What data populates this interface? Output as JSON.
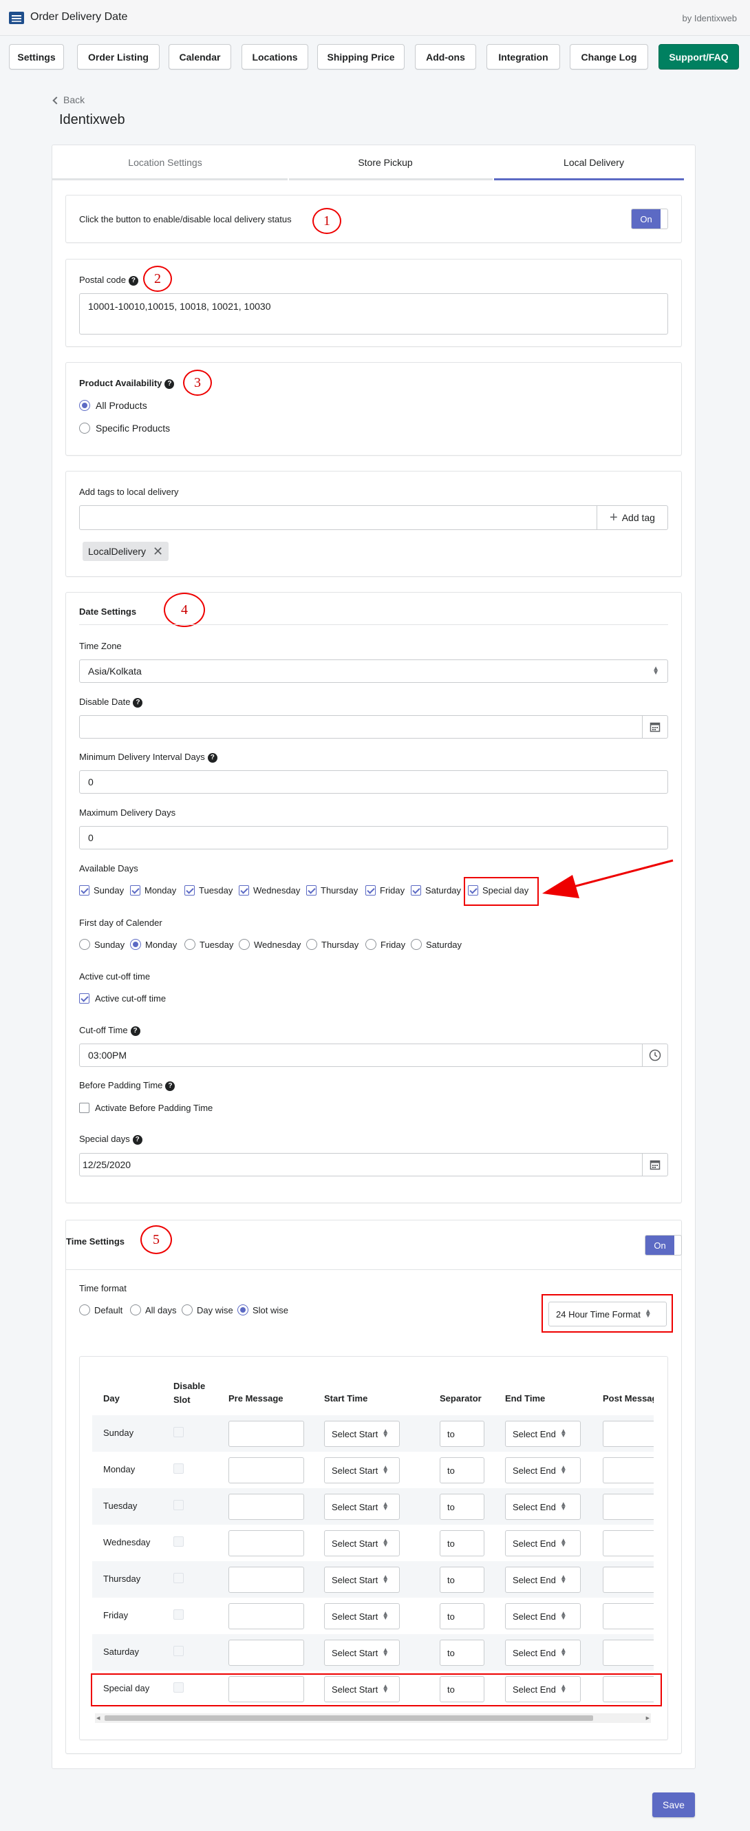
{
  "header": {
    "app_title": "Order Delivery Date",
    "by": "by Identixweb"
  },
  "nav": [
    "Settings",
    "Order Listing",
    "Calendar",
    "Locations",
    "Shipping Price",
    "Add-ons",
    "Integration",
    "Change Log",
    "Support/FAQ"
  ],
  "back_label": "Back",
  "page_title": "Identixweb",
  "tabs": [
    "Location Settings",
    "Store Pickup",
    "Local Delivery"
  ],
  "active_tab": "Local Delivery",
  "annotations": [
    "1",
    "2",
    "3",
    "4",
    "5"
  ],
  "status": {
    "text": "Click the button to enable/disable local delivery status",
    "toggle": "On"
  },
  "postal": {
    "label": "Postal code",
    "value": "10001-10010,10015, 10018, 10021, 10030"
  },
  "product": {
    "title": "Product Availability",
    "options": [
      "All Products",
      "Specific Products"
    ],
    "selected": "All Products"
  },
  "tags": {
    "label": "Add tags to local delivery",
    "button": "Add tag",
    "chip": "LocalDelivery"
  },
  "date_settings": {
    "title": "Date Settings",
    "timezone_label": "Time Zone",
    "timezone_value": "Asia/Kolkata",
    "disable_date_label": "Disable Date",
    "min_interval_label": "Minimum Delivery Interval Days",
    "min_interval_value": "0",
    "max_days_label": "Maximum Delivery Days",
    "max_days_value": "0",
    "available_days_label": "Available Days",
    "available_days": [
      "Sunday",
      "Monday",
      "Tuesday",
      "Wednesday",
      "Thursday",
      "Friday",
      "Saturday",
      "Special day"
    ],
    "first_day_label": "First day of Calender",
    "first_days": [
      "Sunday",
      "Monday",
      "Tuesday",
      "Wednesday",
      "Thursday",
      "Friday",
      "Saturday"
    ],
    "first_day_selected": "Monday",
    "cutoff_section_label": "Active cut-off time",
    "cutoff_checkbox_label": "Active cut-off time",
    "cutoff_time_label": "Cut-off Time",
    "cutoff_time_value": "03:00PM",
    "padding_label": "Before Padding Time",
    "padding_checkbox_label": "Activate Before Padding Time",
    "special_days_label": "Special days",
    "special_days_value": "12/25/2020"
  },
  "time_settings": {
    "title": "Time Settings",
    "toggle": "On",
    "format_label": "Time format",
    "format_options": [
      "Default",
      "All days",
      "Day wise",
      "Slot wise"
    ],
    "format_selected": "Slot wise",
    "hour_format": "24 Hour Time Format",
    "columns": [
      "Day",
      "Disable Slot",
      "Pre Message",
      "Start Time",
      "Separator",
      "End Time",
      "Post Messag"
    ],
    "days": [
      "Sunday",
      "Monday",
      "Tuesday",
      "Wednesday",
      "Thursday",
      "Friday",
      "Saturday",
      "Special day"
    ],
    "start_placeholder": "Select Start",
    "separator": "to",
    "end_placeholder": "Select End"
  },
  "save_label": "Save",
  "colors": {
    "accent": "#5c6ac4",
    "brand_green": "#008060",
    "annotation_red": "#ee0000"
  }
}
